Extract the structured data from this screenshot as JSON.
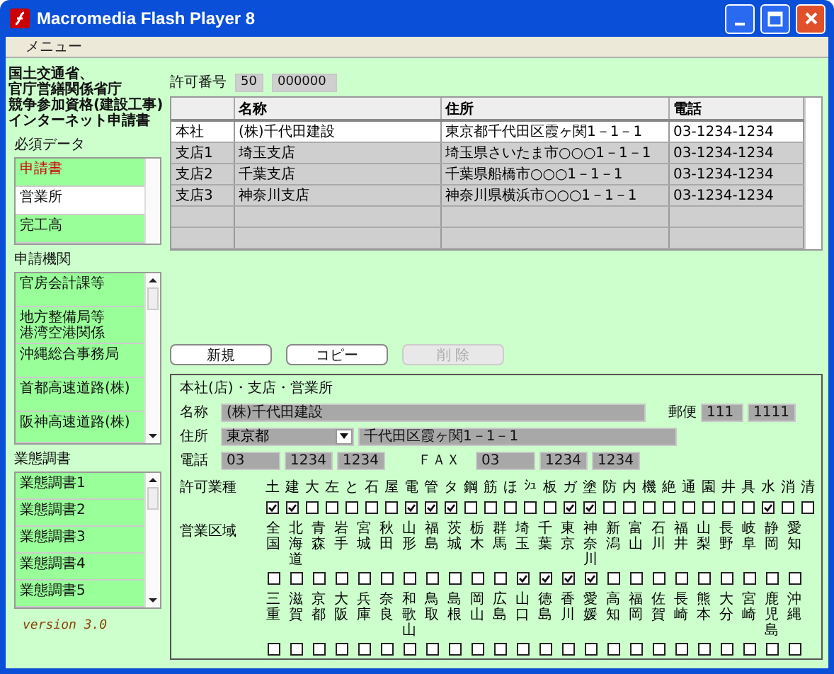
{
  "window": {
    "title": "Macromedia Flash Player 8"
  },
  "menu": [
    "メニュー"
  ],
  "header_lines": [
    "国土交通省、",
    "官庁営繕関係省庁",
    "競争参加資格(建設工事)",
    "インターネット申請書"
  ],
  "required_data": {
    "label": "必須データ",
    "items": [
      {
        "label": "申請書",
        "alert": true,
        "selected": false
      },
      {
        "label": "営業所",
        "alert": false,
        "selected": true
      },
      {
        "label": "完工高",
        "alert": false,
        "selected": false
      }
    ]
  },
  "agencies": {
    "label": "申請機関",
    "items": [
      {
        "label": "官房会計課等"
      },
      {
        "label": "地方整備局等",
        "label_line_2": "港湾空港関係"
      },
      {
        "label": "沖縄総合事務局"
      },
      {
        "label": "首都高速道路(株)"
      },
      {
        "label": "阪神高速道路(株)"
      }
    ]
  },
  "surveys": {
    "label": "業態調書",
    "items": [
      {
        "label": "業態調書1"
      },
      {
        "label": "業態調書2"
      },
      {
        "label": "業態調書3"
      },
      {
        "label": "業態調書4"
      },
      {
        "label": "業態調書5"
      }
    ]
  },
  "version": "version 3.0",
  "permit": {
    "label": "許可番号",
    "prefix": "50",
    "number": "000000"
  },
  "table": {
    "columns": [
      "",
      "名称",
      "住所",
      "電話"
    ],
    "rows": [
      {
        "cells": [
          "本社",
          "(株)千代田建設",
          "東京都千代田区霞ヶ関1－1－1",
          "03-1234-1234"
        ],
        "selected": true
      },
      {
        "cells": [
          "支店1",
          "埼玉支店",
          "埼玉県さいたま市○○○1－1－1",
          "03-1234-1234"
        ],
        "selected": false
      },
      {
        "cells": [
          "支店2",
          "千葉支店",
          "千葉県船橋市○○○1－1－1",
          "03-1234-1234"
        ],
        "selected": false
      },
      {
        "cells": [
          "支店3",
          "神奈川支店",
          "神奈川県横浜市○○○1－1－1",
          "03-1234-1234"
        ],
        "selected": false
      }
    ]
  },
  "buttons": [
    {
      "label": "新規",
      "disabled": false
    },
    {
      "label": "コピー",
      "disabled": false
    },
    {
      "label": "削 除",
      "disabled": true
    }
  ],
  "form": {
    "title": "本社(店)・支店・営業所",
    "name": {
      "label": "名称",
      "value": "(株)千代田建設"
    },
    "postal": {
      "label": "郵便",
      "parts": [
        "111",
        "1111"
      ]
    },
    "address": {
      "label": "住所",
      "prefecture": "東京都",
      "value": "千代田区霞ヶ関1－1－1"
    },
    "phone": {
      "label": "電話",
      "parts": [
        "03",
        "1234",
        "1234"
      ]
    },
    "fax": {
      "label": "ＦＡＸ",
      "parts": [
        "03",
        "1234",
        "1234"
      ]
    },
    "licenses": {
      "label": "許可業種",
      "items": [
        {
          "label": "土",
          "checked": true
        },
        {
          "label": "建",
          "checked": true
        },
        {
          "label": "大",
          "checked": false
        },
        {
          "label": "左",
          "checked": false
        },
        {
          "label": "と",
          "checked": false
        },
        {
          "label": "石",
          "checked": false
        },
        {
          "label": "屋",
          "checked": false
        },
        {
          "label": "電",
          "checked": true
        },
        {
          "label": "管",
          "checked": true
        },
        {
          "label": "タ",
          "checked": true
        },
        {
          "label": "鋼",
          "checked": false
        },
        {
          "label": "筋",
          "checked": false
        },
        {
          "label": "ほ",
          "checked": false
        },
        {
          "label": "ｼｭ",
          "checked": false
        },
        {
          "label": "板",
          "checked": false
        },
        {
          "label": "ガ",
          "checked": true
        },
        {
          "label": "塗",
          "checked": true
        },
        {
          "label": "防",
          "checked": false
        },
        {
          "label": "内",
          "checked": false
        },
        {
          "label": "機",
          "checked": false
        },
        {
          "label": "絶",
          "checked": false
        },
        {
          "label": "通",
          "checked": false
        },
        {
          "label": "園",
          "checked": false
        },
        {
          "label": "井",
          "checked": false
        },
        {
          "label": "具",
          "checked": false
        },
        {
          "label": "水",
          "checked": true
        },
        {
          "label": "消",
          "checked": false
        },
        {
          "label": "清",
          "checked": false
        }
      ]
    },
    "regions": {
      "label": "営業区域",
      "rows": [
        [
          {
            "label": "全国",
            "checked": false
          },
          {
            "label": "北海道",
            "checked": false
          },
          {
            "label": "青森",
            "checked": false
          },
          {
            "label": "岩手",
            "checked": false
          },
          {
            "label": "宮城",
            "checked": false
          },
          {
            "label": "秋田",
            "checked": false
          },
          {
            "label": "山形",
            "checked": false
          },
          {
            "label": "福島",
            "checked": false
          },
          {
            "label": "茨城",
            "checked": false
          },
          {
            "label": "栃木",
            "checked": false
          },
          {
            "label": "群馬",
            "checked": false
          },
          {
            "label": "埼玉",
            "checked": true
          },
          {
            "label": "千葉",
            "checked": true
          },
          {
            "label": "東京",
            "checked": true
          },
          {
            "label": "神奈川",
            "checked": true
          },
          {
            "label": "新潟",
            "checked": false
          },
          {
            "label": "富山",
            "checked": false
          },
          {
            "label": "石川",
            "checked": false
          },
          {
            "label": "福井",
            "checked": false
          },
          {
            "label": "山梨",
            "checked": false
          },
          {
            "label": "長野",
            "checked": false
          },
          {
            "label": "岐阜",
            "checked": false
          },
          {
            "label": "静岡",
            "checked": false
          },
          {
            "label": "愛知",
            "checked": false
          }
        ],
        [
          {
            "label": "三重",
            "checked": false
          },
          {
            "label": "滋賀",
            "checked": false
          },
          {
            "label": "京都",
            "checked": false
          },
          {
            "label": "大阪",
            "checked": false
          },
          {
            "label": "兵庫",
            "checked": false
          },
          {
            "label": "奈良",
            "checked": false
          },
          {
            "label": "和歌山",
            "checked": false
          },
          {
            "label": "鳥取",
            "checked": false
          },
          {
            "label": "島根",
            "checked": false
          },
          {
            "label": "岡山",
            "checked": false
          },
          {
            "label": "広島",
            "checked": false
          },
          {
            "label": "山口",
            "checked": false
          },
          {
            "label": "徳島",
            "checked": false
          },
          {
            "label": "香川",
            "checked": false
          },
          {
            "label": "愛媛",
            "checked": false
          },
          {
            "label": "高知",
            "checked": false
          },
          {
            "label": "福岡",
            "checked": false
          },
          {
            "label": "佐賀",
            "checked": false
          },
          {
            "label": "長崎",
            "checked": false
          },
          {
            "label": "熊本",
            "checked": false
          },
          {
            "label": "大分",
            "checked": false
          },
          {
            "label": "宮崎",
            "checked": false
          },
          {
            "label": "鹿児島",
            "checked": false
          },
          {
            "label": "沖縄",
            "checked": false
          }
        ]
      ]
    }
  }
}
